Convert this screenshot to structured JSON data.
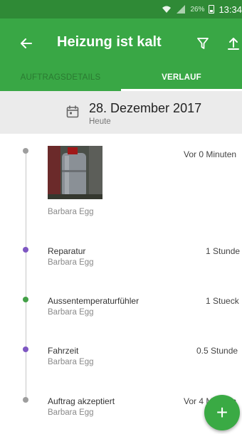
{
  "status_bar": {
    "battery_percent": "26%",
    "time": "13:34"
  },
  "app_bar": {
    "title": "Heizung ist kalt",
    "back_icon": "arrow-back-icon",
    "filter_icon": "filter-icon",
    "upload_icon": "upload-icon"
  },
  "tabs": [
    {
      "label": "AUFTRAGSDETAILS",
      "selected": false
    },
    {
      "label": "VERLAUF",
      "selected": true
    }
  ],
  "date_header": {
    "date": "28. Dezember 2017",
    "relative": "Heute",
    "icon": "calendar-icon"
  },
  "timeline": [
    {
      "type": "photo",
      "value": "Vor 0 Minuten",
      "user": "Barbara Egg",
      "dot_color": "#9e9e9e"
    },
    {
      "type": "item",
      "title": "Reparatur",
      "value": "1 Stunde",
      "user": "Barbara Egg",
      "dot_color": "#7e57c2"
    },
    {
      "type": "item",
      "title": "Aussentemperaturfühler",
      "value": "1 Stueck",
      "user": "Barbara Egg",
      "dot_color": "#43a047"
    },
    {
      "type": "item",
      "title": "Fahrzeit",
      "value": "0.5 Stunde",
      "user": "Barbara Egg",
      "dot_color": "#7e57c2"
    },
    {
      "type": "item",
      "title": "Auftrag akzeptiert",
      "value": "Vor 4 Minuten",
      "user": "Barbara Egg",
      "dot_color": "#9e9e9e"
    }
  ],
  "fab": {
    "label": "+",
    "icon": "add-icon"
  },
  "colors": {
    "app_bar": "#39a745",
    "status_bar": "#2f8a36",
    "date_header_bg": "#ebebeb",
    "fab": "#3aaa44"
  }
}
